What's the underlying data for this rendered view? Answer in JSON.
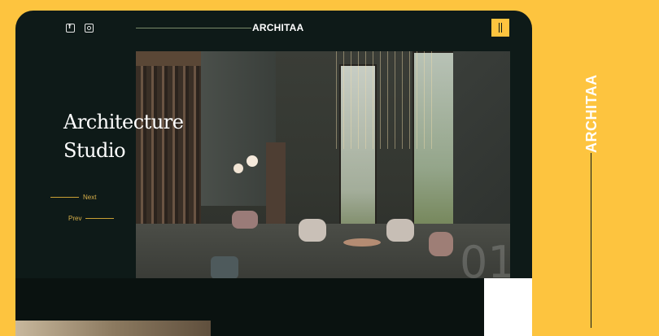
{
  "header": {
    "brand": "ARCHITAA",
    "social": [
      "facebook-icon",
      "instagram-icon"
    ],
    "menu_icon": "menu-icon"
  },
  "hero": {
    "title_line1": "Architecture",
    "title_line2": "Studio",
    "next_label": "Next",
    "prev_label": "Prev",
    "slide_number": "01"
  },
  "side": {
    "brand_vertical": "ARCHITAA"
  },
  "colors": {
    "accent": "#fdc43f",
    "dark": "#0e1a18",
    "gold": "#d8b04a"
  }
}
